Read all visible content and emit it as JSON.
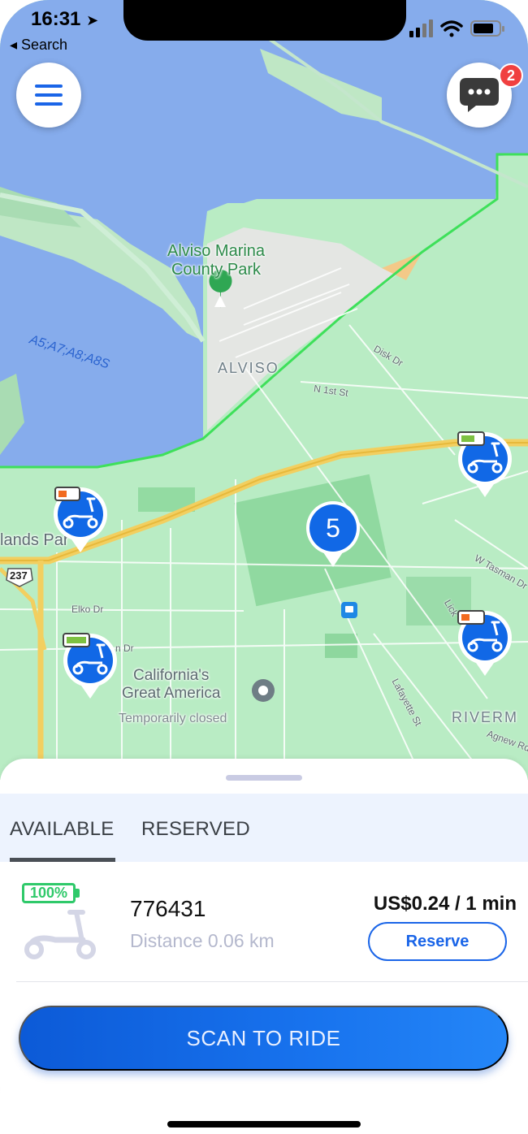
{
  "status_bar": {
    "time": "16:31",
    "back_label": "◂ Search"
  },
  "header": {
    "messages_badge": "2"
  },
  "map": {
    "labels": {
      "park": "Alviso Marina\nCounty Park",
      "water": "A5;A7;A8;A8S",
      "town": "ALVISO",
      "disk_dr": "Disk Dr",
      "n1st": "N 1st St",
      "lands_park": "lands Par",
      "route": "237",
      "elko": "Elko Dr",
      "n_dr": "n Dr",
      "great_america": "California's\nGreat America",
      "closed": "Temporarily closed",
      "tasman": "W Tasman Dr",
      "lick": "Lick",
      "lafayette": "Lafayette St",
      "riverm": "RIVERM",
      "agnew": "Agnew Rd"
    },
    "cluster_count": "5",
    "markers": [
      {
        "battery": "low",
        "color": "#f26b1f"
      },
      {
        "battery": "high",
        "color": "#7dc142"
      },
      {
        "battery": "high",
        "color": "#7dc142"
      },
      {
        "battery": "low",
        "color": "#f26b1f"
      }
    ]
  },
  "sheet": {
    "tabs": {
      "available": "AVAILABLE",
      "reserved": "RESERVED"
    },
    "vehicle": {
      "battery": "100%",
      "id": "776431",
      "distance": "Distance 0.06 km",
      "price": "US$0.24 / 1 min",
      "reserve_label": "Reserve"
    },
    "scan_label": "SCAN TO RIDE"
  },
  "colors": {
    "accent": "#1a65e8",
    "battery_green": "#2fc96a",
    "marker_blue": "#1168e6"
  }
}
